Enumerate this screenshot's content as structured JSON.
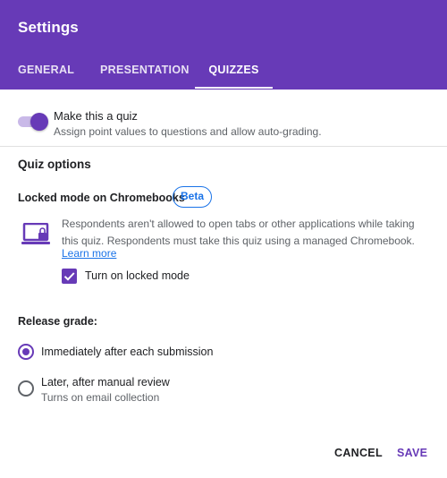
{
  "header": {
    "title": "Settings",
    "tabs": [
      {
        "label": "GENERAL",
        "active": false
      },
      {
        "label": "PRESENTATION",
        "active": false
      },
      {
        "label": "QUIZZES",
        "active": true
      }
    ]
  },
  "quiz_toggle": {
    "title": "Make this a quiz",
    "description": "Assign point values to questions and allow auto-grading.",
    "enabled": true
  },
  "quiz_options": {
    "section_title": "Quiz options",
    "locked_mode": {
      "title": "Locked mode on Chromebooks",
      "badge": "Beta",
      "description": "Respondents aren't allowed to open tabs or other applications while taking this quiz. Respondents must take this quiz using a managed Chromebook.",
      "link": "Learn more",
      "checkbox_label": "Turn on locked mode",
      "checked": true
    }
  },
  "release_grade": {
    "title": "Release grade:",
    "options": [
      {
        "label": "Immediately after each submission",
        "selected": true
      },
      {
        "label": "Later, after manual review",
        "sub": "Turns on email collection",
        "selected": false
      }
    ]
  },
  "actions": {
    "cancel": "CANCEL",
    "save": "SAVE"
  },
  "colors": {
    "accent": "#673ab7",
    "link": "#1a73e8"
  },
  "icons": [
    "laptop-lock-icon",
    "check-icon"
  ]
}
